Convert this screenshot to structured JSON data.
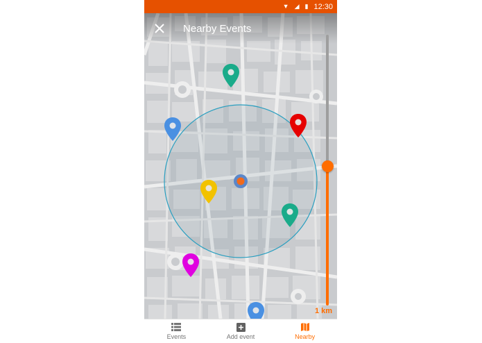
{
  "status": {
    "time": "12:30",
    "wifi_icon": "wifi-icon",
    "signal_icon": "signal-icon",
    "battery_icon": "battery-icon",
    "color": "#e65100"
  },
  "header": {
    "title": "Nearby Events",
    "close_icon": "close-icon"
  },
  "map": {
    "user_location_icon": "my-location-icon",
    "radius_circle_color": "#2a9fc0"
  },
  "pins": [
    {
      "color": "#1aab8a",
      "icon": "map-pin-icon"
    },
    {
      "color": "#4a90e2",
      "icon": "map-pin-icon"
    },
    {
      "color": "#e60000",
      "icon": "map-pin-icon"
    },
    {
      "color": "#f2c200",
      "icon": "map-pin-icon"
    },
    {
      "color": "#1aab8a",
      "icon": "map-pin-icon"
    },
    {
      "color": "#e000e0",
      "icon": "map-pin-icon"
    },
    {
      "color": "#4a90e2",
      "icon": "map-pin-icon"
    }
  ],
  "radius_slider": {
    "label": "1 km",
    "accent": "#ff6d00",
    "value_fraction": 0.5
  },
  "bottom_nav": {
    "items": [
      {
        "label": "Events",
        "icon": "list-icon",
        "active": false
      },
      {
        "label": "Add event",
        "icon": "add-box-icon",
        "active": false
      },
      {
        "label": "Nearby",
        "icon": "map-icon",
        "active": true
      }
    ]
  }
}
